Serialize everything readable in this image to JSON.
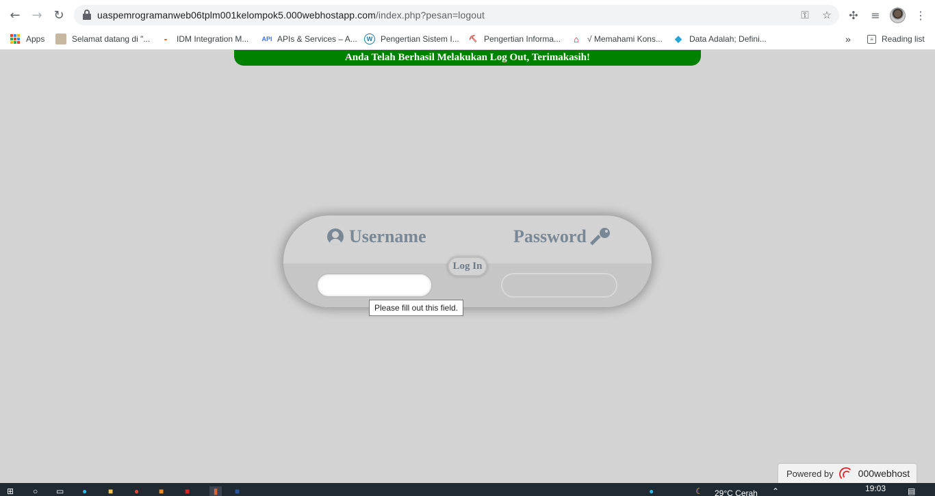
{
  "browser": {
    "url_host": "uaspemrogramanweb06tplm001kelompok5.000webhostapp.com",
    "url_path": "/index.php?pesan=logout",
    "bookmarks": [
      {
        "label": "Apps",
        "icon": "apps-grid-icon"
      },
      {
        "label": "Selamat datang di \"...",
        "icon": "person-favicon"
      },
      {
        "label": "IDM Integration M...",
        "icon": "idm-favicon"
      },
      {
        "label": "APIs & Services – A...",
        "icon": "api-favicon"
      },
      {
        "label": "Pengertian Sistem I...",
        "icon": "wordpress-favicon"
      },
      {
        "label": "Pengertian Informa...",
        "icon": "tool-favicon"
      },
      {
        "label": "√ Memahami Kons...",
        "icon": "house-favicon"
      },
      {
        "label": "Data Adalah; Defini...",
        "icon": "gem-favicon"
      }
    ],
    "overflow_label": "»",
    "reading_list_label": "Reading list"
  },
  "page": {
    "banner_text": "Anda Telah Berhasil Melakukan Log Out, Terimakasih!",
    "username_label": "Username",
    "password_label": "Password",
    "login_button": "Log In",
    "username_value": "",
    "password_value": "",
    "tooltip_text": "Please fill out this field."
  },
  "footer": {
    "powered_by": "Powered by",
    "brand": "000webhost"
  },
  "taskbar": {
    "weather": "29°C  Cerah",
    "time": "19:03"
  },
  "colors": {
    "page_bg": "#d3d3d3",
    "banner_bg": "#008000",
    "label_color": "#7a8794",
    "taskbar_bg": "#1f2a33"
  }
}
